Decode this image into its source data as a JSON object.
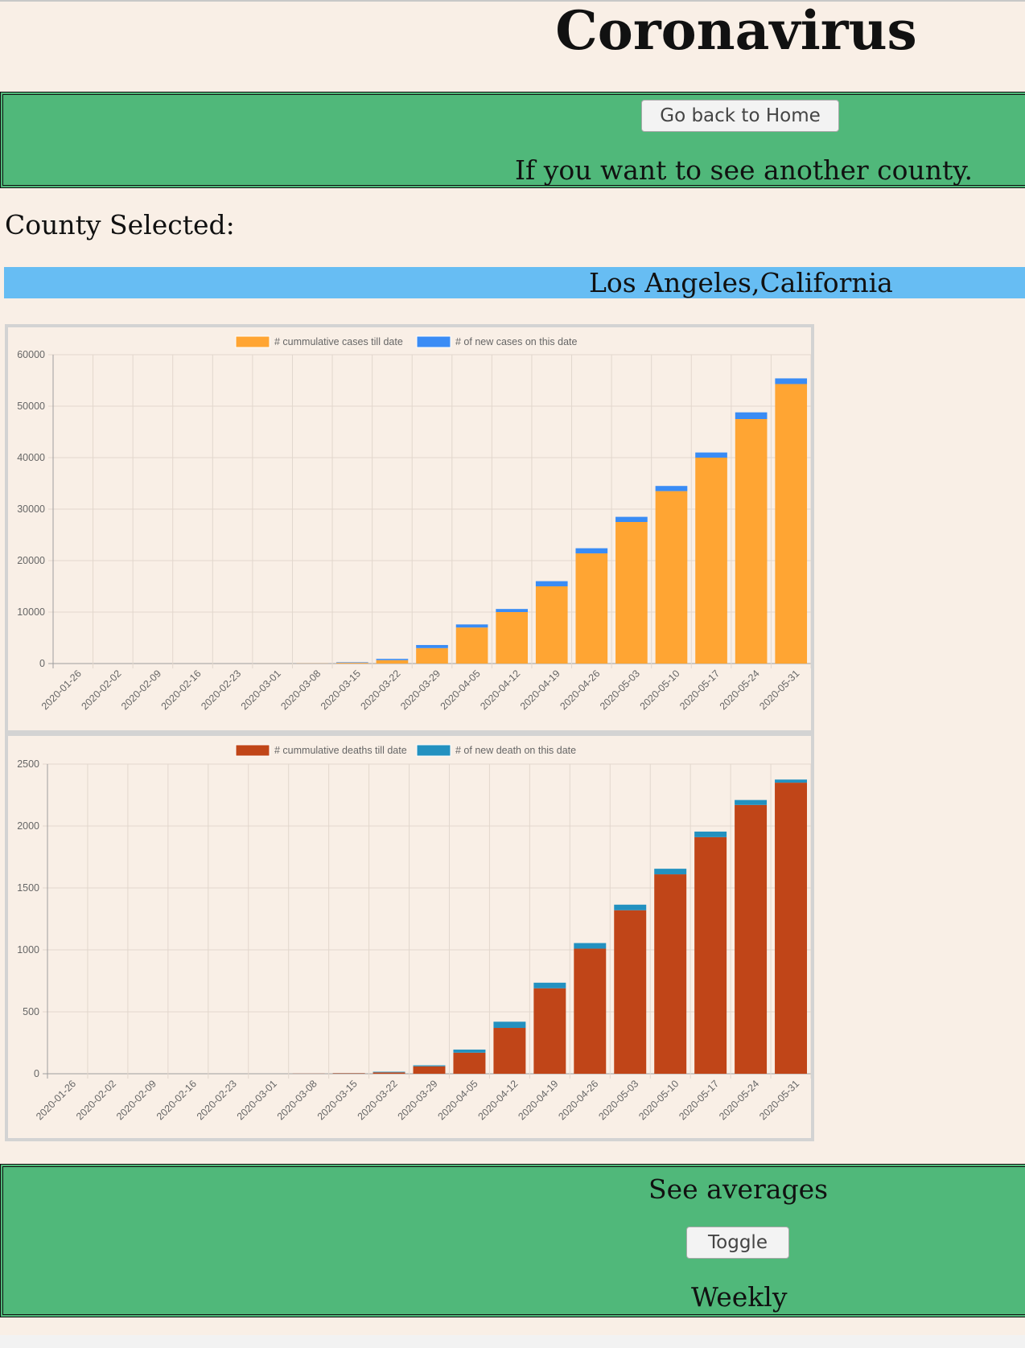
{
  "header": {
    "title": "Coronavirus"
  },
  "nav": {
    "home_button": "Go back to Home",
    "hint": "If you want to see another county."
  },
  "county": {
    "label": "County Selected:",
    "name": "Los Angeles,California"
  },
  "averages": {
    "title": "See averages",
    "toggle_button": "Toggle",
    "mode": "Weekly"
  },
  "chart_data": [
    {
      "type": "bar",
      "stacked": true,
      "categories": [
        "2020-01-26",
        "2020-02-02",
        "2020-02-09",
        "2020-02-16",
        "2020-02-23",
        "2020-03-01",
        "2020-03-08",
        "2020-03-15",
        "2020-03-22",
        "2020-03-29",
        "2020-04-05",
        "2020-04-12",
        "2020-04-19",
        "2020-04-26",
        "2020-05-03",
        "2020-05-10",
        "2020-05-17",
        "2020-05-24",
        "2020-05-31"
      ],
      "series": [
        {
          "name": "# cummulative cases till date",
          "color": "#ffa533",
          "values": [
            1,
            1,
            1,
            1,
            1,
            7,
            40,
            150,
            660,
            3000,
            7000,
            10000,
            15000,
            21400,
            27500,
            33500,
            40000,
            47500,
            54300
          ]
        },
        {
          "name": "# of new cases on this date",
          "color": "#3a8cf5",
          "values": [
            0,
            0,
            0,
            0,
            0,
            1,
            10,
            100,
            250,
            600,
            600,
            600,
            1000,
            1000,
            1000,
            1000,
            1000,
            1300,
            1100
          ]
        }
      ],
      "ylim": [
        0,
        60000
      ],
      "yticks": [
        0,
        10000,
        20000,
        30000,
        40000,
        50000,
        60000
      ],
      "grid": true,
      "legend": "top-center"
    },
    {
      "type": "bar",
      "stacked": true,
      "categories": [
        "2020-01-26",
        "2020-02-02",
        "2020-02-09",
        "2020-02-16",
        "2020-02-23",
        "2020-03-01",
        "2020-03-08",
        "2020-03-15",
        "2020-03-22",
        "2020-03-29",
        "2020-04-05",
        "2020-04-12",
        "2020-04-19",
        "2020-04-26",
        "2020-05-03",
        "2020-05-10",
        "2020-05-17",
        "2020-05-24",
        "2020-05-31"
      ],
      "series": [
        {
          "name": "# cummulative deaths till date",
          "color": "#c04518",
          "values": [
            0,
            0,
            0,
            0,
            0,
            0,
            1,
            4,
            11,
            60,
            170,
            370,
            690,
            1010,
            1320,
            1610,
            1910,
            2170,
            2350
          ]
        },
        {
          "name": "# of new death on this date",
          "color": "#2391c0",
          "values": [
            0,
            0,
            0,
            0,
            0,
            0,
            0,
            1,
            5,
            8,
            25,
            50,
            45,
            45,
            45,
            45,
            45,
            40,
            25
          ]
        }
      ],
      "ylim": [
        0,
        2500
      ],
      "yticks": [
        0,
        500,
        1000,
        1500,
        2000,
        2500
      ],
      "grid": true,
      "legend": "top-center"
    }
  ]
}
